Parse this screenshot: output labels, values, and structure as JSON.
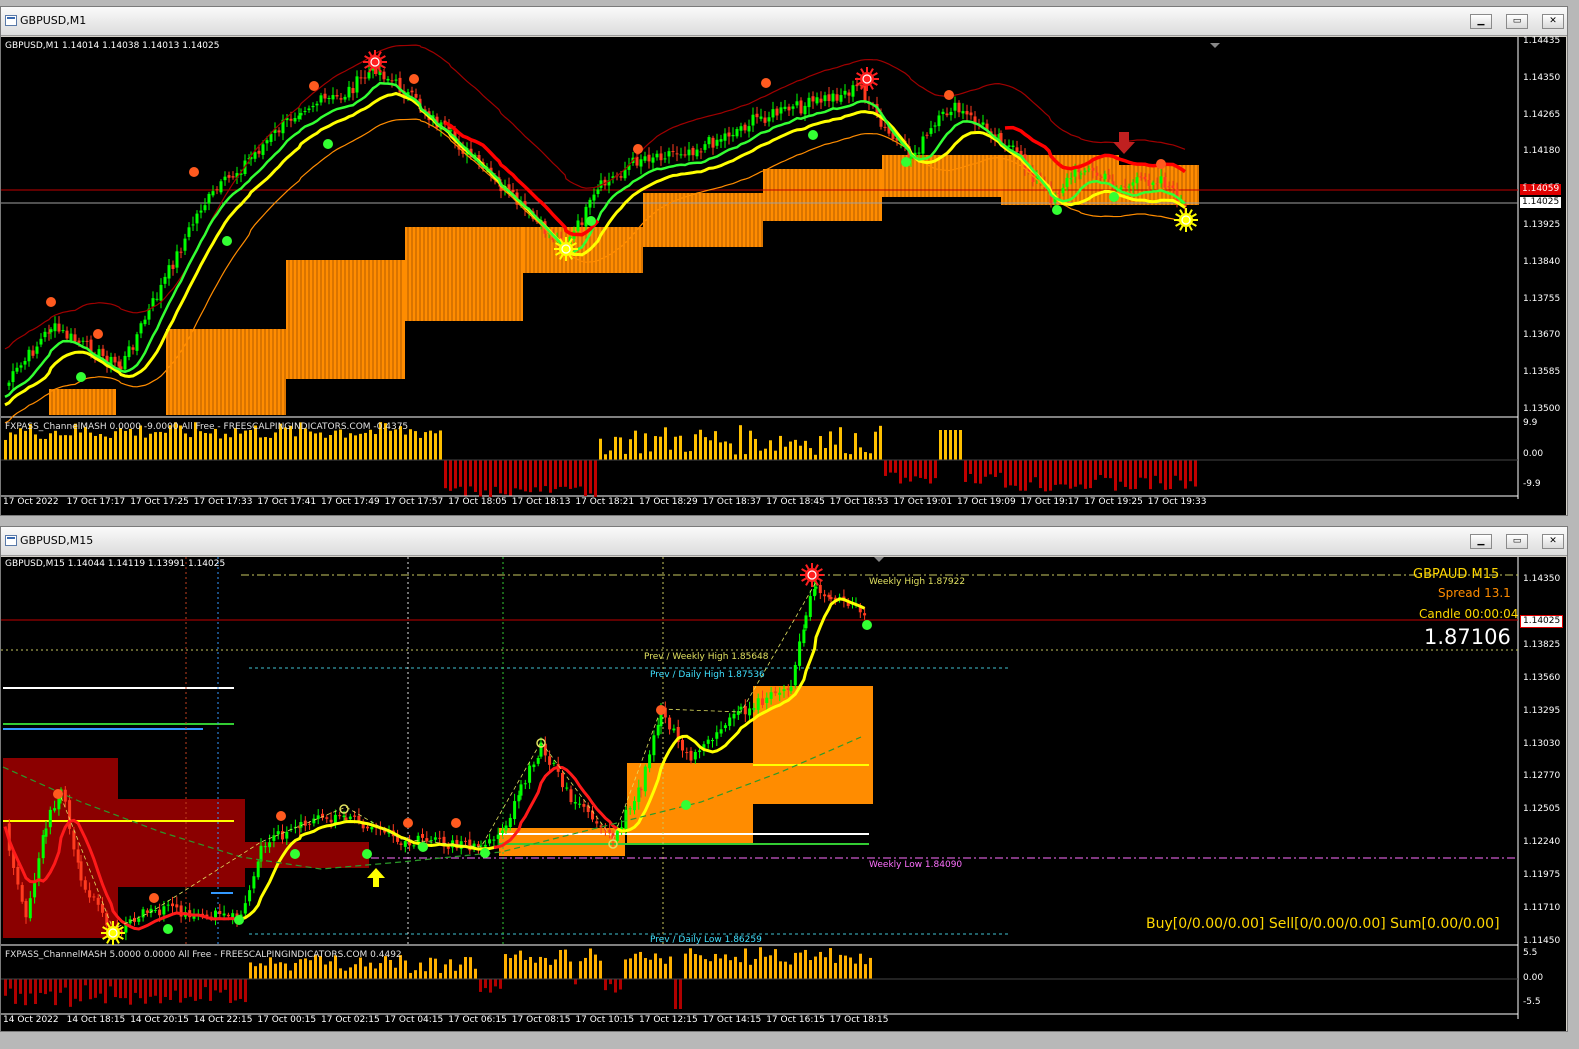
{
  "top_window": {
    "title": "GBPUSD,M1",
    "chart_info": "GBPUSD,M1  1.14014 1.14038 1.14013 1.14025",
    "price_axis": [
      "1.14435",
      "1.14350",
      "1.14265",
      "1.14180",
      "1.14095",
      "1.14025",
      "1.13925",
      "1.13840",
      "1.13755",
      "1.13670",
      "1.13585",
      "1.13500"
    ],
    "price_tag_red": "1.14059",
    "price_tag_white": "1.14025",
    "indicator_label": "FXPASS_ChannelMASH 0.0000 -9.0000  All Free - FREESCALPINGINDICATORS.COM -0.4375",
    "indicator_axis": [
      "9.9",
      "0.00",
      "-9.9"
    ],
    "time_axis": [
      "17 Oct 2022",
      "17 Oct 17:17",
      "17 Oct 17:25",
      "17 Oct 17:33",
      "17 Oct 17:41",
      "17 Oct 17:49",
      "17 Oct 17:57",
      "17 Oct 18:05",
      "17 Oct 18:13",
      "17 Oct 18:21",
      "17 Oct 18:29",
      "17 Oct 18:37",
      "17 Oct 18:45",
      "17 Oct 18:53",
      "17 Oct 19:01",
      "17 Oct 19:09",
      "17 Oct 19:17",
      "17 Oct 19:25",
      "17 Oct 19:33"
    ]
  },
  "bottom_window": {
    "title": "GBPUSD,M15",
    "chart_info": "GBPUSD,M15  1.14044 1.14119 1.13991 1.14025",
    "price_axis": [
      "1.14350",
      "1.14025",
      "1.13825",
      "1.13560",
      "1.13295",
      "1.13030",
      "1.12770",
      "1.12505",
      "1.12240",
      "1.11975",
      "1.11710",
      "1.11450"
    ],
    "price_tag_red": "1.14025",
    "panel_symbol": "GBPAUD  M15",
    "panel_spread": "Spread 13.1",
    "panel_candle": "Candle 00:00:04",
    "panel_price": "1.87106",
    "panel_orders": "Buy[0/0.00/0.00] Sell[0/0.00/0.00] Sum[0.00/0.00]",
    "level_weekly_high": "Weekly High 1.87922",
    "level_prev_weekly_high": "Prev / Weekly High 1.85648",
    "level_prev_daily_high": "Prev / Daily High 1.87536",
    "level_weekly_low": "Weekly Low 1.84090",
    "level_prev_daily_low": "Prev / Daily Low 1.86259",
    "indicator_label": "FXPASS_ChannelMASH 5.0000 0.0000  All Free - FREESCALPINGINDICATORS.COM 0.4492",
    "indicator_axis": [
      "5.5",
      "0.00",
      "-5.5"
    ],
    "time_axis": [
      "14 Oct 2022",
      "14 Oct 18:15",
      "14 Oct 20:15",
      "14 Oct 22:15",
      "17 Oct 00:15",
      "17 Oct 02:15",
      "17 Oct 04:15",
      "17 Oct 06:15",
      "17 Oct 08:15",
      "17 Oct 10:15",
      "17 Oct 12:15",
      "17 Oct 14:15",
      "17 Oct 16:15",
      "17 Oct 18:15"
    ]
  },
  "colors": {
    "bull": "#00ff00",
    "bear": "#ff3b1f",
    "cloud": "#ff8c00",
    "yellow": "#ffff00",
    "green": "#00e000",
    "red": "#ff0000",
    "brown": "#8b0000"
  },
  "window_buttons": {
    "minimize": "▁",
    "restore": "▭",
    "close": "✕"
  }
}
